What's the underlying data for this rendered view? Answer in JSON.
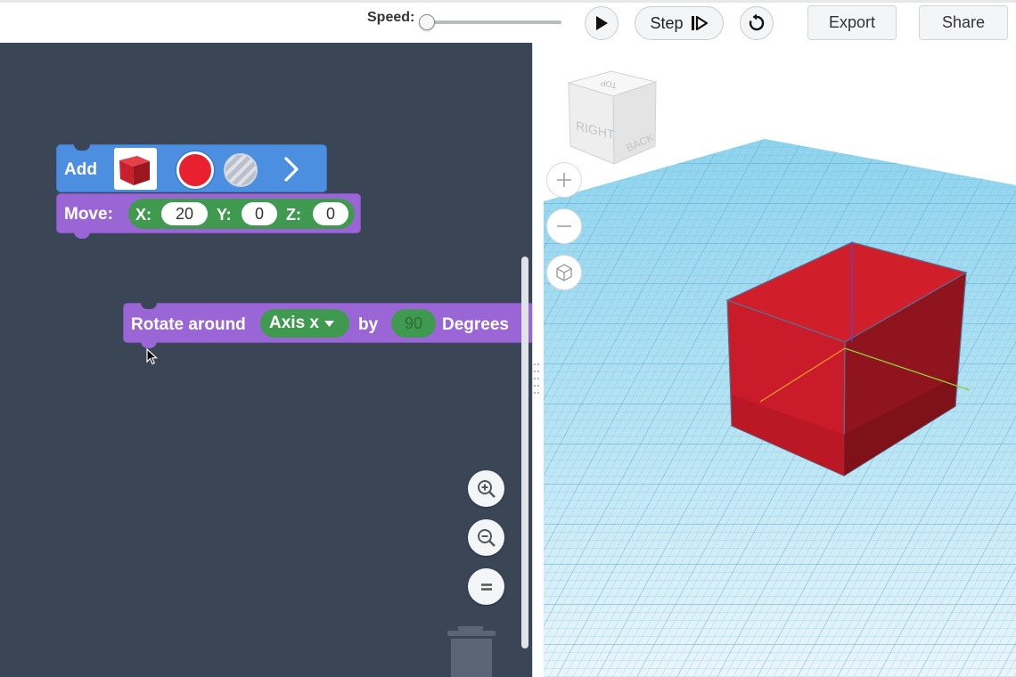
{
  "toolbar": {
    "speed_label": "Speed:",
    "speed_value": 0,
    "step_label": "Step",
    "export_label": "Export",
    "share_label": "Share",
    "icons": {
      "play": "play-icon",
      "step": "step-forward-icon",
      "reset": "reset-icon"
    }
  },
  "workspace": {
    "background": "#3a4556",
    "add_block": {
      "label": "Add",
      "shape": "cube",
      "color": "#e8202f",
      "alt_material": "hole-striped",
      "arrow": "chevron-right-icon"
    },
    "move_block": {
      "label": "Move:",
      "x_label": "X:",
      "x_value": "20",
      "y_label": "Y:",
      "y_value": "0",
      "z_label": "Z:",
      "z_value": "0"
    },
    "rotate_block": {
      "label": "Rotate around",
      "axis_value": "Axis x",
      "by_label": "by",
      "degrees_value": "90",
      "degrees_label": "Degrees"
    },
    "zoom_controls": [
      "zoom-in-icon",
      "zoom-out-icon",
      "zoom-reset-icon"
    ],
    "trash": "trash-icon"
  },
  "viewport": {
    "view_cube_faces": {
      "top": "TOP",
      "right": "RIGHT",
      "back": "BACK"
    },
    "controls": [
      "plus-icon",
      "minus-icon",
      "view-home-icon"
    ],
    "object": {
      "shape": "box",
      "color": "#cc1f2b"
    }
  }
}
